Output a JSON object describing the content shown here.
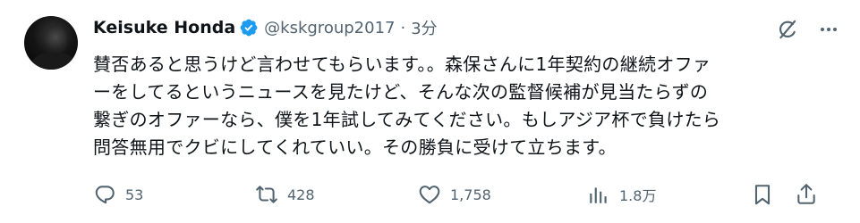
{
  "author": {
    "name": "Keisuke Honda",
    "handle": "@kskgroup2017",
    "separator": "·",
    "time": "3分",
    "verified_color": "#1d9bf0"
  },
  "top_icons": [
    "grok-icon",
    "more-icon"
  ],
  "tweet": {
    "lines": [
      "賛否あると思うけど言わせてもらいます。。森保さんに1年契約の継続オファ",
      "ーをしてるというニュースを見たけど、そんな次の監督候補が見当たらずの",
      "繋ぎのオファーなら、僕を1年試してみてください。もしアジア杯で負けたら",
      "問答無用でクビにしてくれていい。その勝負に受けて立ちます。"
    ]
  },
  "actions": {
    "reply": {
      "icon": "reply-icon",
      "count": "53"
    },
    "retweet": {
      "icon": "retweet-icon",
      "count": "428"
    },
    "like": {
      "icon": "heart-icon",
      "count": "1,758"
    },
    "views": {
      "icon": "analytics-icon",
      "count": "1.8万"
    },
    "bookmark": {
      "icon": "bookmark-icon"
    },
    "share": {
      "icon": "share-icon"
    }
  },
  "colors": {
    "text": "#0f1419",
    "muted": "#536471",
    "accent": "#1d9bf0"
  }
}
